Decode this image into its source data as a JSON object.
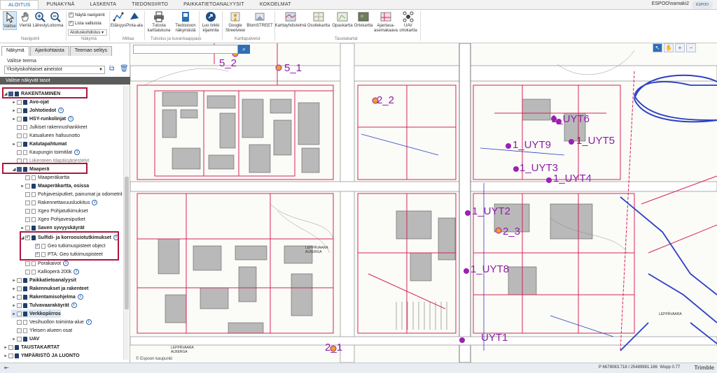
{
  "ribbon_tabs": [
    "ALOITUS",
    "PUNAKYNÄ",
    "LASKENTA",
    "TIEDONSIIRTO",
    "PAIKKATIETOANALYYSIT",
    "KOKOELMAT"
  ],
  "user": "ESPOO\\namaki2",
  "logo_text": "ESPOO ESBO",
  "ribbon": {
    "nav": [
      "Valitse",
      "Vieritä",
      "Lähesty",
      "Loitonna"
    ],
    "nav_group": "Navigointi",
    "show_navigator": "Näytä navigointi",
    "list_selected": "Lista valituista",
    "selection_tool": "Aloituskohdistus",
    "view_group": "Näkymä",
    "measure": [
      "Etäisyys",
      "Pinta-ala"
    ],
    "measure_group": "Mittaa",
    "print": [
      "Tulosta karttalukuna",
      "Tiedostoon näkymästä"
    ],
    "print_group": "Tulostus ja kuvankaappaus",
    "share": [
      "Luo linkki kijainnila"
    ],
    "services": [
      "Google Streetview",
      "BlomSTREET"
    ],
    "services_group": "Karttapalvelut",
    "bg_maps": [
      "Karttayhdistelmä",
      "Osoitekartta",
      "Opaskartta",
      "Ortokartta",
      "Ajantasa-asemakaava",
      "UAV ortokartta"
    ],
    "bg_group": "Taustakartat"
  },
  "panel": {
    "tabs": [
      "Näkymä",
      "Ajankohtaista",
      "Teeman selitys"
    ],
    "theme_label": "Valitse teema",
    "theme_value": "Yksityiskohtaiset aineistot",
    "layers_header": "Valitse näkyvät tasot",
    "layers": [
      {
        "label": "RAKENTAMINEN",
        "bold": true
      },
      {
        "label": "Avo-ojat",
        "bold": true
      },
      {
        "label": "Johtotiedot",
        "bold": true,
        "info": true
      },
      {
        "label": "HSY-runkolinjat",
        "bold": true,
        "info": true
      },
      {
        "label": "Julkiset rakennushankkeet",
        "bold": false
      },
      {
        "label": "Katualueen haltuunotto",
        "bold": false
      },
      {
        "label": "Katutapahtumat",
        "bold": true
      },
      {
        "label": "Kaupungin toimitilat",
        "bold": false,
        "info": true
      },
      {
        "label": "Liikenteen tilapäisjärjestelyt",
        "bold": false
      },
      {
        "label": "Maaperä",
        "bold": true
      },
      {
        "label": "Maaperäkartta",
        "bold": false
      },
      {
        "label": "Maaperäkartta, osissa",
        "bold": true
      },
      {
        "label": "Pohjavesiputket, painumat ja odometrit",
        "bold": false
      },
      {
        "label": "Rakennettavuusluokitus",
        "bold": false,
        "info": true
      },
      {
        "label": "Xgeo Pohjatutkimukset",
        "bold": false
      },
      {
        "label": "Xgeo Pohjavesiputket",
        "bold": false
      },
      {
        "label": "Saven syvyyskäyrät",
        "bold": true
      },
      {
        "label": "Sulfidi- ja korroosiotutkimukset",
        "bold": true,
        "info": true
      },
      {
        "label": "Geo tutkimuspisteet object",
        "bold": false
      },
      {
        "label": "PTA: Geo tutkimuspisteet",
        "bold": false
      },
      {
        "label": "Porakaivot",
        "bold": false,
        "info": true
      },
      {
        "label": "Kallioperä 200k",
        "bold": false,
        "info": true
      },
      {
        "label": "Paikkatietoanalyysit",
        "bold": true
      },
      {
        "label": "Rakennukset ja rakenteet",
        "bold": true
      },
      {
        "label": "Rakentamisohjelma",
        "bold": true,
        "info": true
      },
      {
        "label": "Tulvavaarakäyrät",
        "bold": true,
        "info": true
      },
      {
        "label": "Verkkopiirros",
        "bold": true
      },
      {
        "label": "Vesihuollon toiminta-alue",
        "bold": false,
        "info": true
      },
      {
        "label": "Yleisen alueen osat",
        "bold": false
      },
      {
        "label": "UAV",
        "bold": true
      },
      {
        "label": "TAUSTAKARTAT",
        "bold": true
      },
      {
        "label": "YMPÄRISTÖ JA LUONTO",
        "bold": true
      }
    ]
  },
  "map_labels": [
    "5_2",
    "5_1",
    "2_2",
    "1_UYT6",
    "1_UYT9",
    "1_UYT5",
    "1_UYT3",
    "1_UYT4",
    "1_UYT2",
    "2_3",
    "1_UYT8",
    "UYT1",
    "2_1"
  ],
  "map_copyright": "© Espoon kaupunki",
  "street_labels": [
    "LEPPÄVAARA ALBERGA",
    "LEPPÄVAARA ALBERGA",
    "LEPPÄVAARA"
  ],
  "status": {
    "coords": "P 6678083.718 I 25489981.186",
    "zoom": "Wopp 0.77",
    "brand": "Trimble"
  },
  "colors": {
    "accent": "#2f6fb3",
    "highlight": "#b0153e",
    "label": "#8e1fa6",
    "map_pink": "#d4245c",
    "map_blue": "#2b3fc4"
  }
}
